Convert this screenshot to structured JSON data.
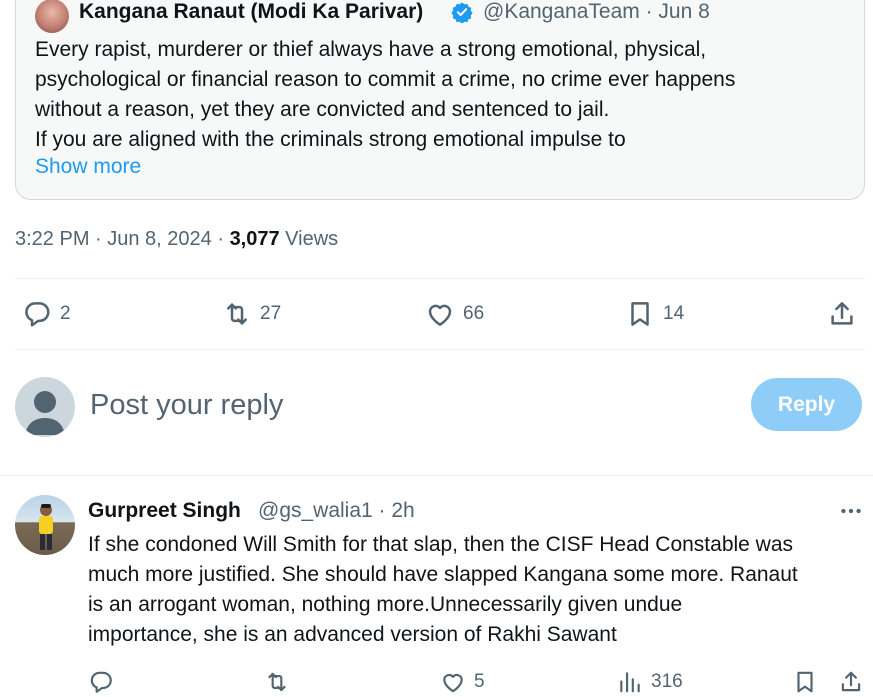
{
  "quoted_tweet": {
    "author_name": "Kangana Ranaut (Modi Ka Parivar)",
    "handle_date": "@KanganaTeam · Jun 8",
    "text_lines": [
      "Every rapist, murderer or thief always have a strong emotional, physical,",
      "psychological or financial reason to commit a crime, no crime ever happens",
      "without a reason, yet they are convicted and sentenced to jail.",
      "If you are aligned with the criminals strong emotional impulse to"
    ],
    "show_more_label": "Show more"
  },
  "meta": {
    "time_date": "3:22 PM · Jun 8, 2024 · ",
    "views_count": "3,077",
    "views_label": " Views"
  },
  "actions": {
    "replies": "2",
    "reposts": "27",
    "likes": "66",
    "bookmarks": "14"
  },
  "composer": {
    "placeholder": "Post your reply",
    "reply_button": "Reply"
  },
  "reply": {
    "author_name": "Gurpreet Singh",
    "handle_time": "@gs_walia1 · 2h",
    "text_lines": [
      "If she condoned Will Smith for that slap, then the CISF Head Constable was",
      "much more justified. She should have slapped Kangana some more. Ranaut",
      "is an arrogant woman, nothing more.Unnecessarily given undue",
      "importance, she is an advanced version of Rakhi Sawant"
    ],
    "actions": {
      "replies": "",
      "reposts": "",
      "likes": "5",
      "views": "316"
    }
  },
  "colors": {
    "link": "#1d9bf0",
    "muted": "#536471",
    "reply_button_bg": "#8ecdf8",
    "verified": "#1d9bf0"
  }
}
